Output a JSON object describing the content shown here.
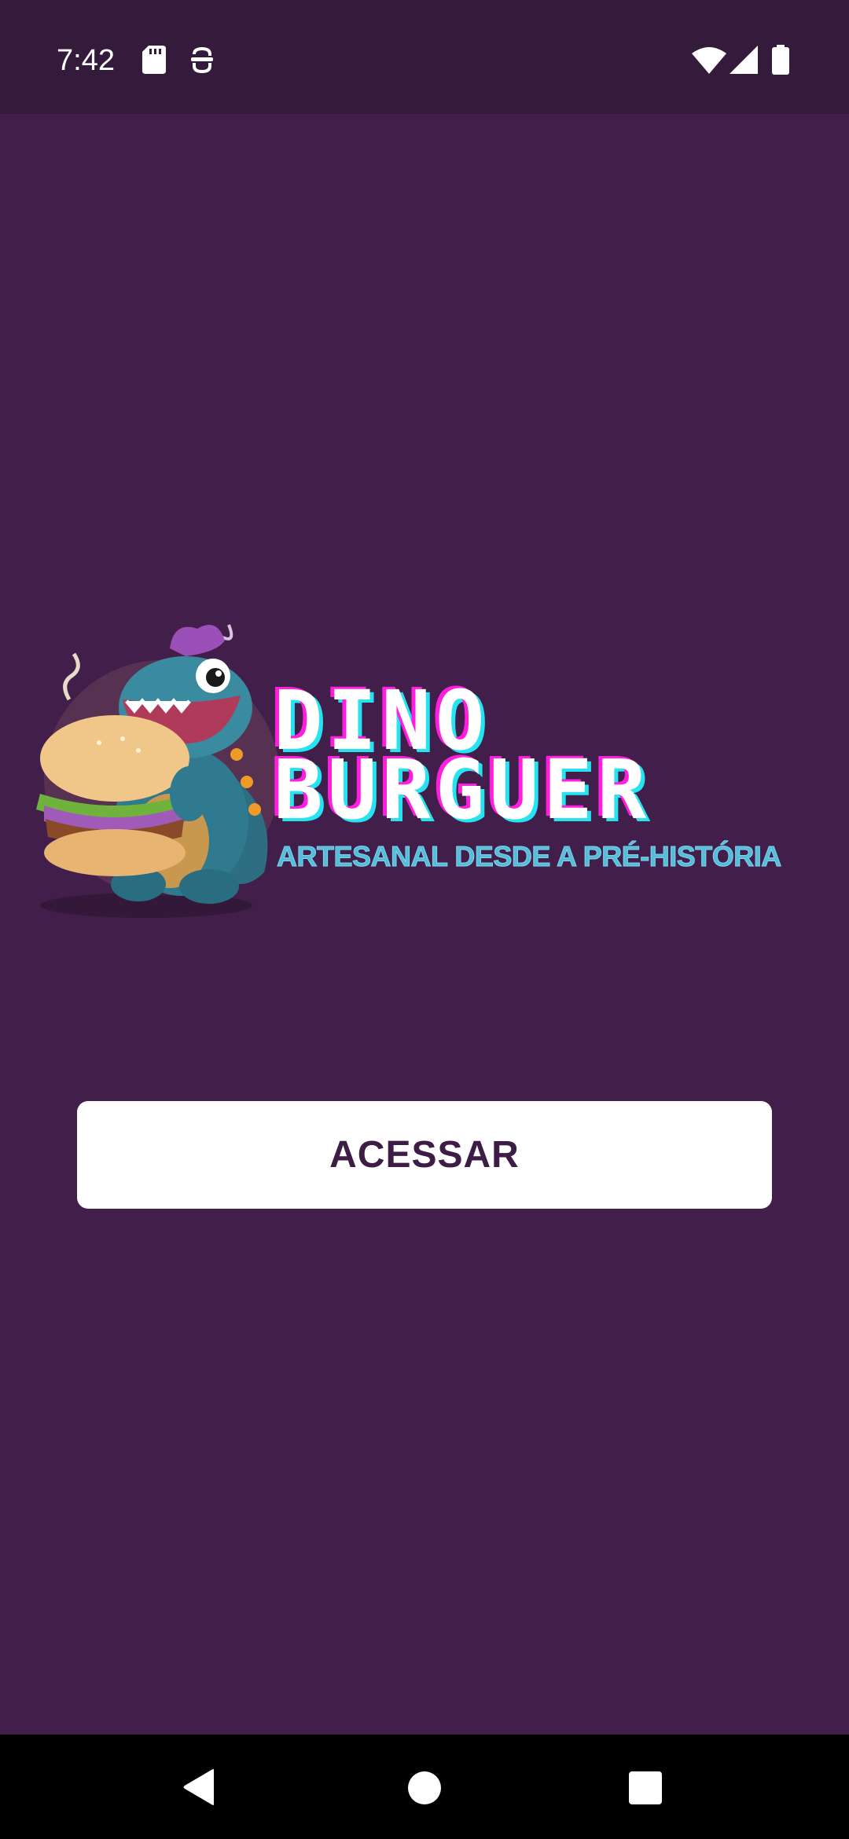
{
  "status_bar": {
    "time": "7:42",
    "icons": [
      "sd-card-icon",
      "vpn-key-icon",
      "wifi-icon",
      "cell-signal-icon",
      "battery-icon"
    ]
  },
  "logo": {
    "line1": "DINO",
    "line2": "BURGUER",
    "tagline": "ARTESANAL DESDE A PRÉ-HISTÓRIA",
    "mascot_icon": "dinosaur-eating-burger-icon"
  },
  "main": {
    "access_button_label": "ACESSAR"
  },
  "nav_bar": {
    "icons": [
      "back-icon",
      "home-icon",
      "recents-icon"
    ]
  },
  "colors": {
    "background": "#421f4b",
    "status_bar": "#341a3b",
    "button_bg": "#ffffff",
    "button_text": "#3d1d46",
    "logo_magenta": "#ff1ee0",
    "logo_cyan": "#25e3f0",
    "tagline": "#56bcd8",
    "nav_bar": "#000000"
  }
}
